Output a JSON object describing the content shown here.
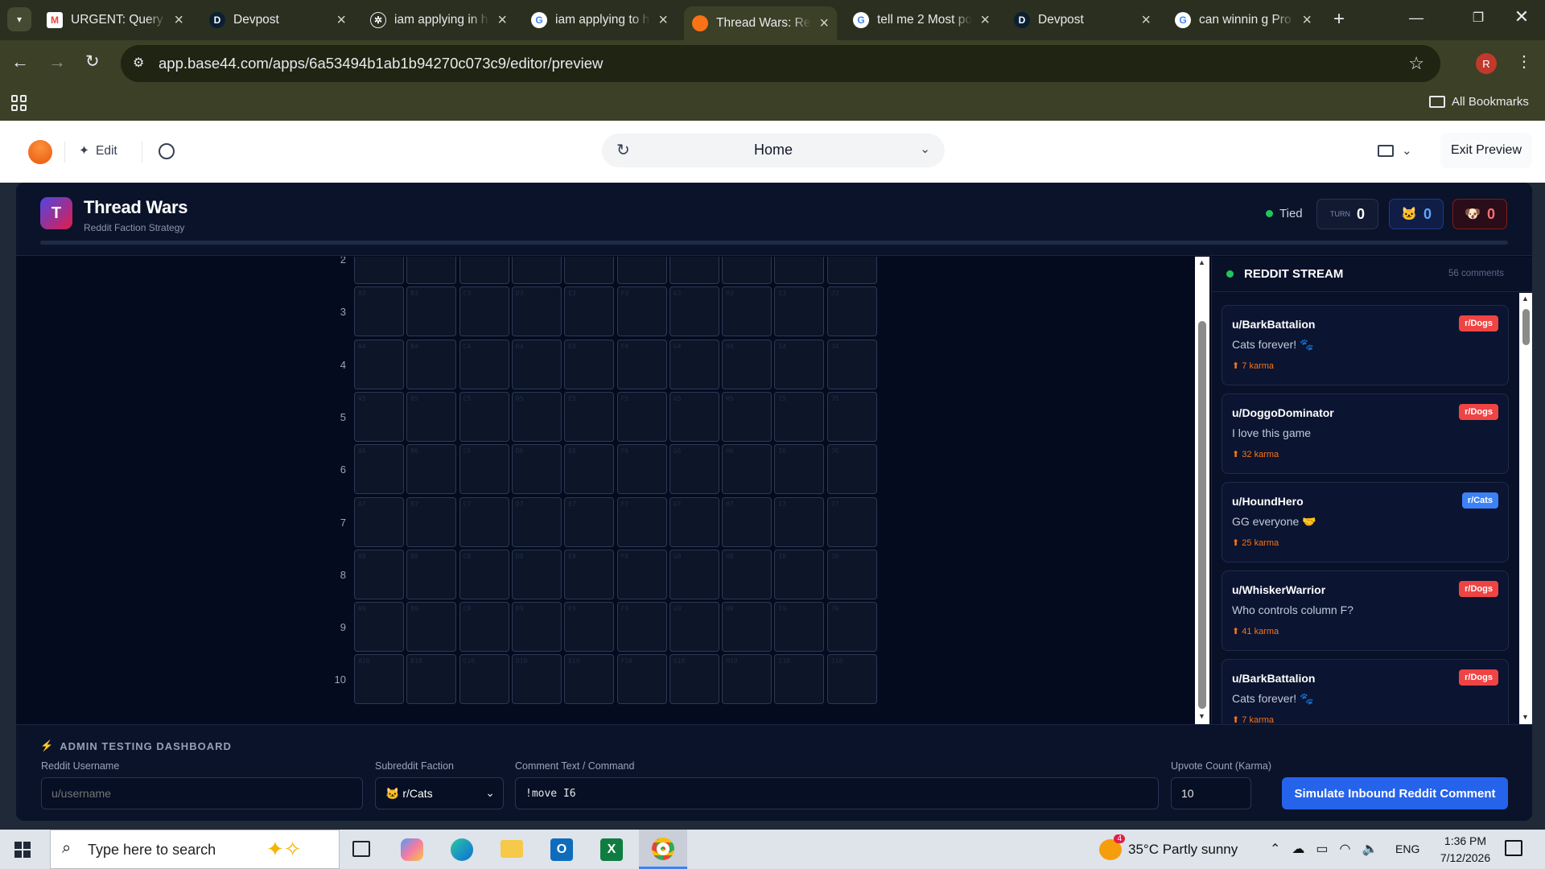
{
  "browser": {
    "tabs": [
      {
        "title": "URGENT: Query f",
        "icon": "gmail-icon"
      },
      {
        "title": "Devpost",
        "icon": "devpost-icon"
      },
      {
        "title": "iam applying in h",
        "icon": "openai-icon"
      },
      {
        "title": "iam applying to h",
        "icon": "google-icon"
      },
      {
        "title": "Thread Wars: Red",
        "icon": "base44-icon"
      },
      {
        "title": "tell me 2 Most po",
        "icon": "google-icon"
      },
      {
        "title": "Devpost",
        "icon": "devpost-icon"
      },
      {
        "title": "can winnin g Pro",
        "icon": "google-icon"
      }
    ],
    "url": "app.base44.com/apps/6a53494b1ab1b94270c073c9/editor/preview",
    "profile_initial": "R",
    "bookmarks_label": "All Bookmarks"
  },
  "editor": {
    "edit_label": "Edit",
    "page_selector": "Home",
    "exit_label": "Exit Preview"
  },
  "app": {
    "logo_letter": "T",
    "title": "Thread Wars",
    "subtitle": "Reddit Faction Strategy",
    "status": "Tied",
    "turn_label": "TURN",
    "turn_value": "0",
    "cats_score": "0",
    "dogs_score": "0",
    "colors": {
      "cats": "#3b82f6",
      "dogs": "#ef4444",
      "accent": "#f97316",
      "background": "#040b1f"
    }
  },
  "board": {
    "columns": [
      "A",
      "B",
      "C",
      "D",
      "E",
      "F",
      "G",
      "H",
      "I",
      "J"
    ],
    "rows": [
      "2",
      "3",
      "4",
      "5",
      "6",
      "7",
      "8",
      "9",
      "10"
    ]
  },
  "stream": {
    "title": "REDDIT STREAM",
    "count": "56 comments",
    "comments": [
      {
        "user": "u/BarkBattalion",
        "faction": "r/Dogs",
        "text": "Cats forever! 🐾",
        "karma": "⬆ 7 karma"
      },
      {
        "user": "u/DoggoDominator",
        "faction": "r/Dogs",
        "text": "I love this game",
        "karma": "⬆ 32 karma"
      },
      {
        "user": "u/HoundHero",
        "faction": "r/Cats",
        "text": "GG everyone 🤝",
        "karma": "⬆ 25 karma"
      },
      {
        "user": "u/WhiskerWarrior",
        "faction": "r/Dogs",
        "text": "Who controls column F?",
        "karma": "⬆ 41 karma"
      },
      {
        "user": "u/BarkBattalion",
        "faction": "r/Dogs",
        "text": "Cats forever! 🐾",
        "karma": "⬆ 7 karma"
      }
    ]
  },
  "admin": {
    "title": "ADMIN TESTING DASHBOARD",
    "username_label": "Reddit Username",
    "username_placeholder": "u/username",
    "faction_label": "Subreddit Faction",
    "faction_value": "🐱 r/Cats",
    "comment_label": "Comment Text / Command",
    "comment_value": "!move I6",
    "upvote_label": "Upvote Count (Karma)",
    "upvote_value": "10",
    "submit_label": "Simulate Inbound Reddit Comment"
  },
  "taskbar": {
    "search_placeholder": "Type here to search",
    "weather": "35°C  Partly sunny",
    "weather_badge": "4",
    "lang": "ENG",
    "time": "1:36 PM",
    "date": "7/12/2026"
  }
}
